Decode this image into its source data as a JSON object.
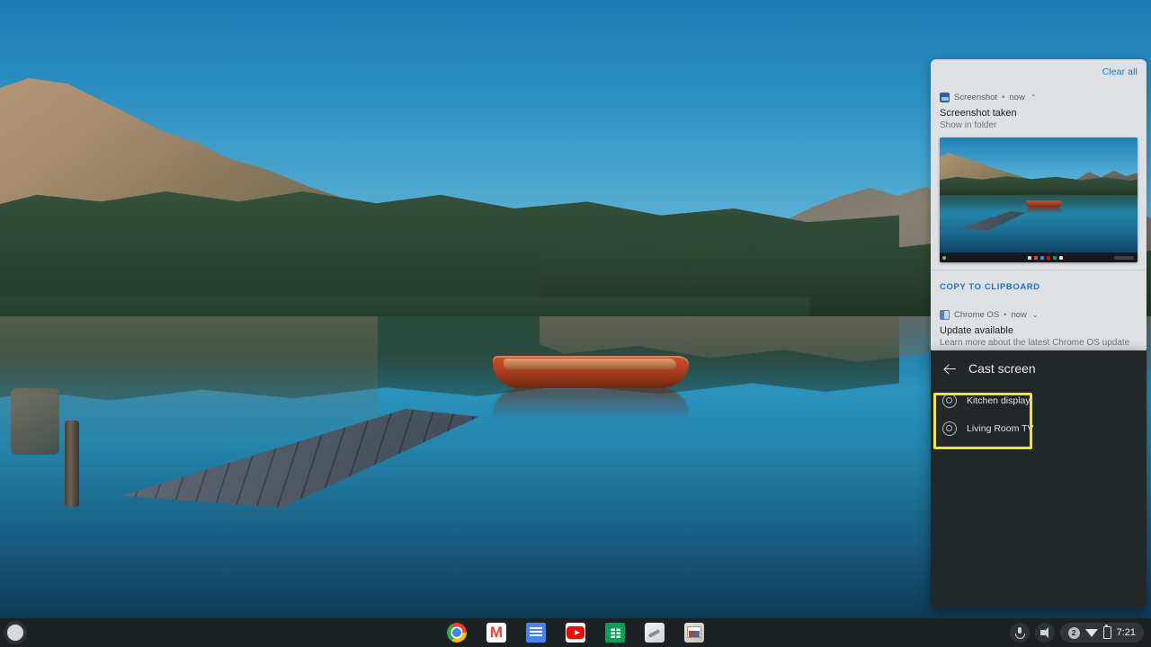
{
  "desktop": {
    "wallpaper_alt": "Mountain lake at sunrise with wooden dock and red rowboat"
  },
  "notification_panel": {
    "clear_all_label": "Clear all",
    "notifications": [
      {
        "app_name": "Screenshot",
        "separator": "•",
        "time": "now",
        "chevron": "⌃",
        "title": "Screenshot taken",
        "body": "Show in folder",
        "icon": "screenshot-image-icon",
        "has_thumbnail": true,
        "action_label": "COPY TO CLIPBOARD"
      },
      {
        "app_name": "Chrome OS",
        "separator": "•",
        "time": "now",
        "chevron": "⌄",
        "title": "Update available",
        "body": "Learn more about the latest Chrome OS update",
        "icon": "chromeos-update-icon",
        "has_thumbnail": false,
        "action_label": ""
      }
    ]
  },
  "cast_panel": {
    "back_icon": "back-arrow-icon",
    "title": "Cast screen",
    "devices": [
      {
        "name": "Kitchen display",
        "icon": "cast-device-icon"
      },
      {
        "name": "Living Room TV",
        "icon": "cast-device-icon"
      }
    ],
    "highlight_color": "#f5e625"
  },
  "shelf": {
    "launcher_label": "launcher-button",
    "apps": [
      {
        "name": "Chrome"
      },
      {
        "name": "Gmail"
      },
      {
        "name": "Google Docs"
      },
      {
        "name": "YouTube"
      },
      {
        "name": "Google Sheets"
      },
      {
        "name": "Paint"
      },
      {
        "name": "Photos"
      }
    ],
    "tray": {
      "mic_icon": "microphone-icon",
      "volume_icon": "volume-icon",
      "notification_count": "2",
      "wifi_icon": "wifi-icon",
      "battery_icon": "battery-icon",
      "time": "7:21"
    }
  }
}
